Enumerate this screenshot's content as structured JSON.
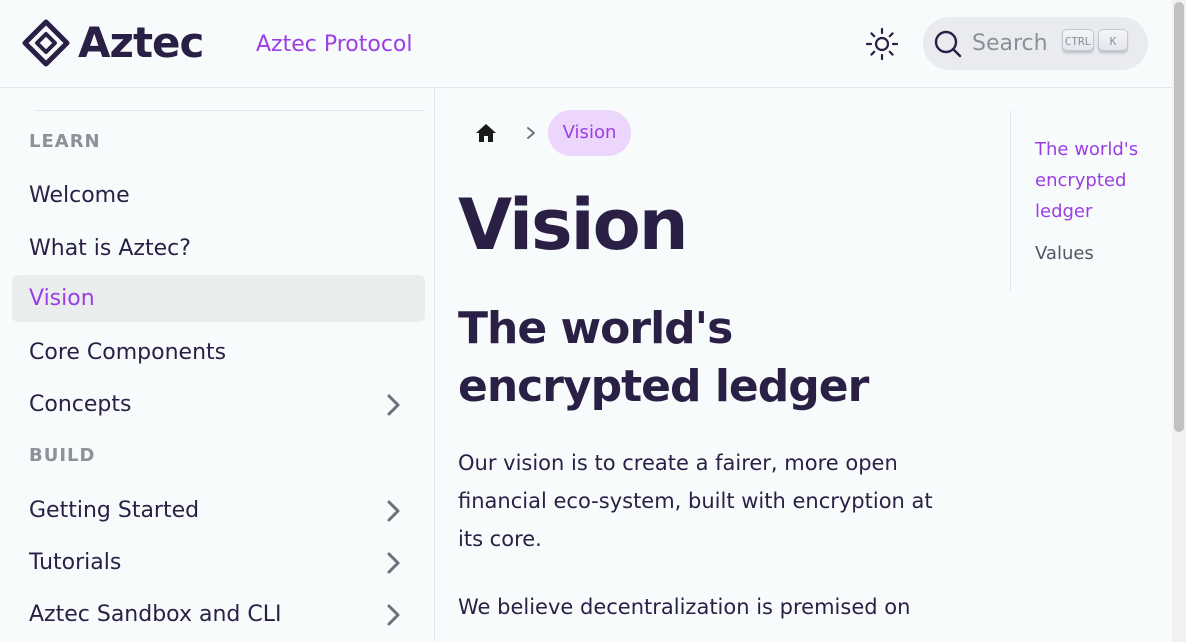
{
  "navbar": {
    "logo_text": "Aztec",
    "link": "Aztec Protocol",
    "search": {
      "label": "Search",
      "kbd_ctrl": "CTRL",
      "kbd_k": "K"
    },
    "theme_icon": "sun-icon"
  },
  "sidebar": {
    "sections": [
      {
        "title": "LEARN"
      },
      {
        "title": "BUILD"
      }
    ],
    "items": [
      {
        "label": "Welcome",
        "active": false,
        "expandable": false
      },
      {
        "label": "What is Aztec?",
        "active": false,
        "expandable": false
      },
      {
        "label": "Vision",
        "active": true,
        "expandable": false
      },
      {
        "label": "Core Components",
        "active": false,
        "expandable": false
      },
      {
        "label": "Concepts",
        "active": false,
        "expandable": true
      },
      {
        "label": "Getting Started",
        "active": false,
        "expandable": true
      },
      {
        "label": "Tutorials",
        "active": false,
        "expandable": true
      },
      {
        "label": "Aztec Sandbox and CLI",
        "active": false,
        "expandable": true
      }
    ]
  },
  "breadcrumb": {
    "home_icon": "home-icon",
    "current": "Vision"
  },
  "main": {
    "title": "Vision",
    "heading": "The world's encrypted ledger",
    "paragraphs": [
      "Our vision is to create a fairer, more open financial eco-system, built with encryption at its core.",
      "We believe decentralization is premised on"
    ]
  },
  "toc": {
    "items": [
      {
        "label": "The world's encrypted ledger",
        "active": true
      },
      {
        "label": "Values",
        "active": false
      }
    ]
  },
  "colors": {
    "accent": "#9b3ee6",
    "text": "#2a1f45",
    "muted": "#8d919a"
  }
}
